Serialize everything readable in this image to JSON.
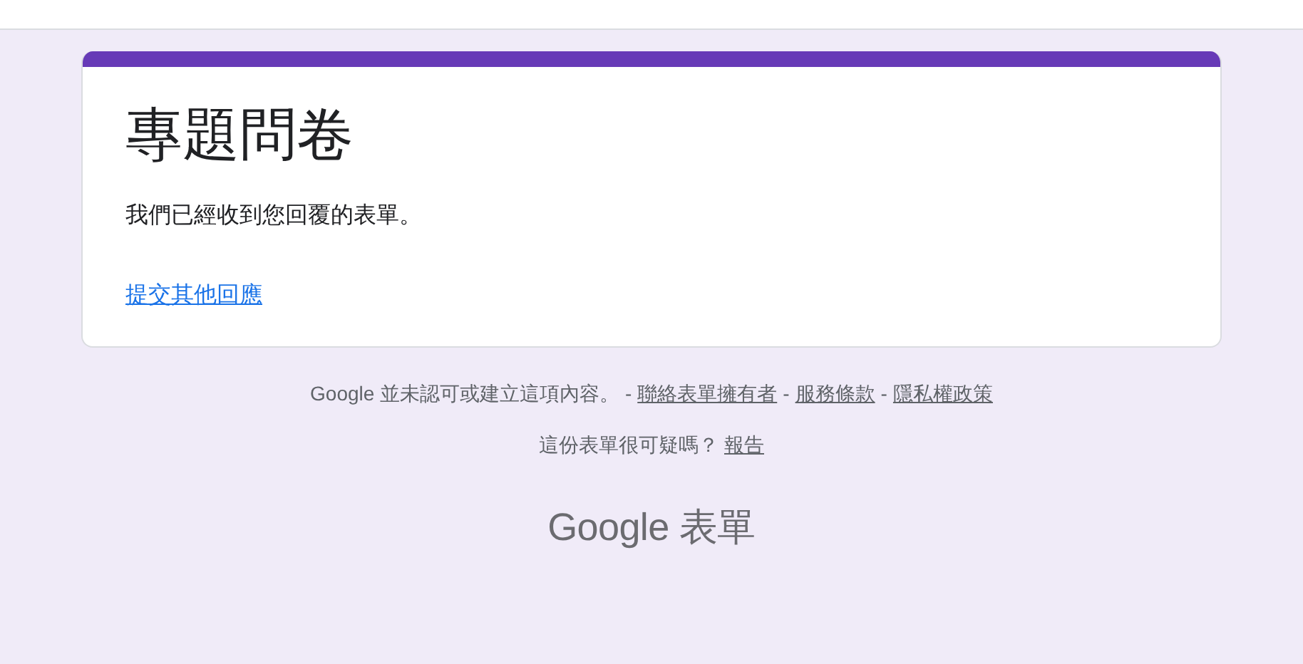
{
  "card": {
    "title": "專題問卷",
    "message": "我們已經收到您回覆的表單。",
    "link": "提交其他回應"
  },
  "footer": {
    "disclaimer": "Google 並未認可或建立這項內容。 -",
    "links": [
      {
        "label": "聯絡表單擁有者",
        "separator": "-"
      },
      {
        "label": "服務條款",
        "separator": "-"
      },
      {
        "label": "隱私權政策"
      }
    ],
    "question": "這份表單很可疑嗎？",
    "report": "報告"
  },
  "logo": "Google 表單"
}
